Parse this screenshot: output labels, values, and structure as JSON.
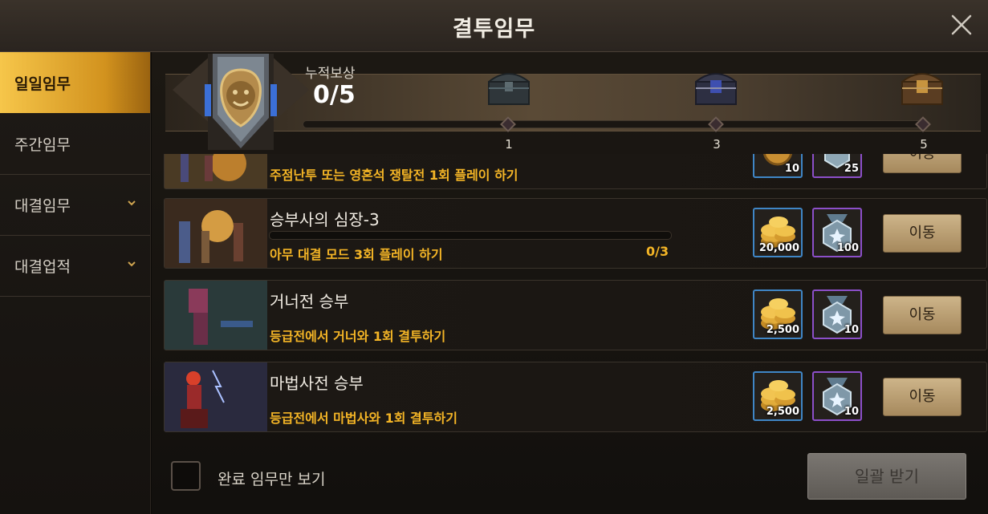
{
  "window": {
    "title": "결투임무"
  },
  "sidebar": {
    "items": [
      {
        "label": "일일임무",
        "active": true,
        "has_chevron": false
      },
      {
        "label": "주간임무",
        "active": false,
        "has_chevron": false
      },
      {
        "label": "대결임무",
        "active": false,
        "has_chevron": true
      },
      {
        "label": "대결업적",
        "active": false,
        "has_chevron": true
      }
    ]
  },
  "accumulated": {
    "label": "누적보상",
    "value": "0/5",
    "progress_fraction": 0,
    "milestones": [
      {
        "label": "1",
        "chest": "chest-tier1-icon"
      },
      {
        "label": "3",
        "chest": "chest-tier2-icon"
      },
      {
        "label": "5",
        "chest": "chest-tier3-icon"
      }
    ]
  },
  "quests": [
    {
      "title": "",
      "desc": "주점난투 또는 영혼석 쟁탈전 1회 플레이 하기",
      "gold": "10",
      "gem": "25",
      "button": "이동",
      "partial": true
    },
    {
      "title": "승부사의 심장-3",
      "desc": "아무 대결 모드 3회 플레이 하기",
      "count": "0/3",
      "progress_fraction": 0,
      "gold": "20,000",
      "gem": "100",
      "button": "이동"
    },
    {
      "title": "거너전 승부",
      "desc": "등급전에서 거너와 1회 결투하기",
      "gold": "2,500",
      "gem": "10",
      "button": "이동"
    },
    {
      "title": "마법사전 승부",
      "desc": "등급전에서 마법사와 1회 결투하기",
      "gold": "2,500",
      "gem": "10",
      "button": "이동"
    }
  ],
  "footer": {
    "checkbox_label": "완료 임무만 보기",
    "checkbox_checked": false,
    "collect_label": "일괄 받기",
    "collect_enabled": false
  },
  "colors": {
    "accent_gold": "#f4b526",
    "active_tab": "#e0a838",
    "button": "#c0a57a"
  }
}
